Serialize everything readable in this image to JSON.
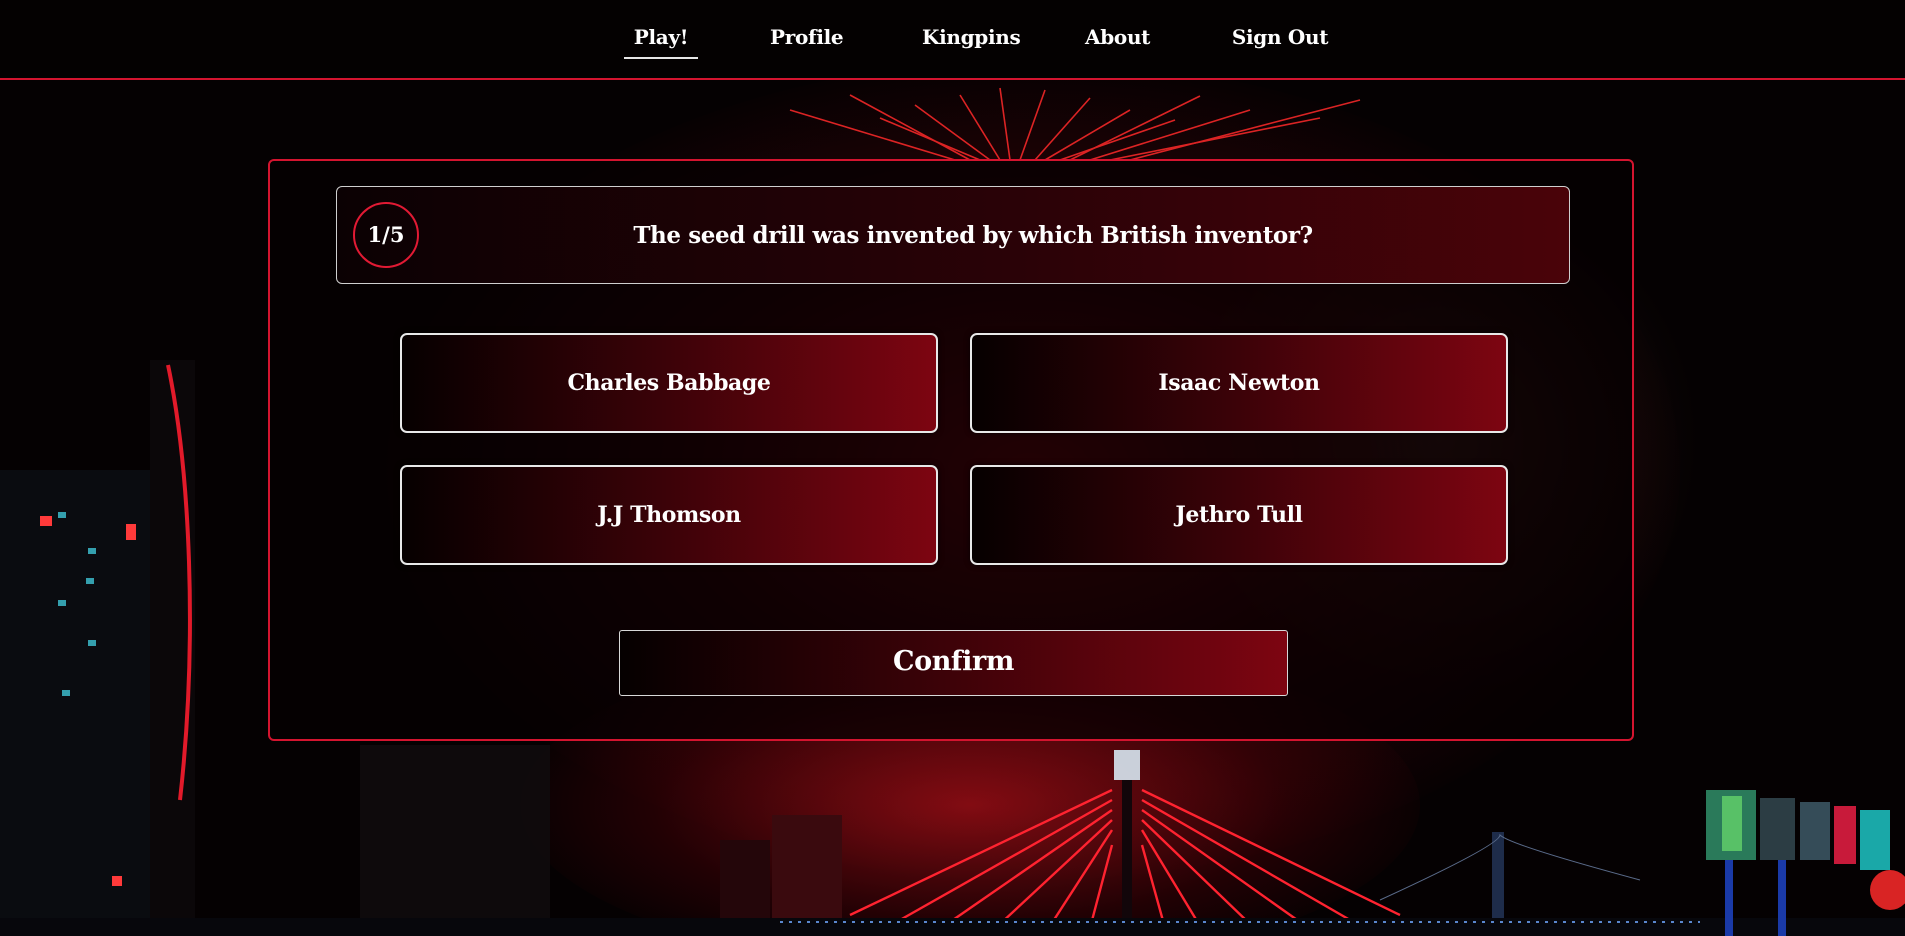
{
  "nav": {
    "items": [
      {
        "label": "Play!"
      },
      {
        "label": "Profile"
      },
      {
        "label": "Kingpins"
      },
      {
        "label": "About"
      },
      {
        "label": "Sign Out"
      }
    ],
    "active_index": 0
  },
  "quiz": {
    "counter": "1/5",
    "question": "The seed drill was invented by which British inventor?",
    "options": [
      {
        "label": "Charles Babbage"
      },
      {
        "label": "Isaac Newton"
      },
      {
        "label": "J.J Thomson"
      },
      {
        "label": "Jethro Tull"
      }
    ],
    "confirm_label": "Confirm"
  },
  "colors": {
    "accent": "#d4142f",
    "background": "#050102",
    "button_gradient_end": "#7d0511"
  }
}
